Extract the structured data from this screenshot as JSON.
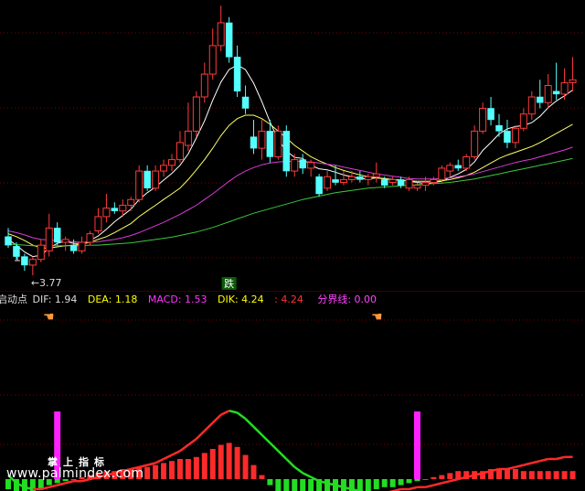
{
  "colors": {
    "background": "#000000",
    "up_candle": "#ff3b3b",
    "down_candle": "#54ffff",
    "ma_white": "#ffffff",
    "ma_yellow": "#ffff66",
    "ma_magenta": "#d83cd8",
    "ma_green": "#3cc83c",
    "dif_label": "#dcdcdc",
    "dea_label": "#ffff00",
    "macd_label": "#ff33ff",
    "dik_label": "#ffff00",
    "dik_value2": "#ff3333",
    "boundary_label": "#ff44ff",
    "signal_bar": "#ff22ff",
    "hist_pos": "#ff2a2a",
    "hist_neg": "#22dd22",
    "dif_line_pos": "#ff2a2a",
    "dif_line_neg": "#22dd22",
    "grid": "#7a0000"
  },
  "annotations": {
    "low_price": "3.77",
    "low_arrow": "←",
    "fall_badge": "跌"
  },
  "legend": {
    "start_point": "启动点",
    "dif": "DIF: 1.94",
    "dea": "DEA: 1.18",
    "macd": "MACD: 1.53",
    "dik": "DIK: 4.24",
    "dik_value2": ": 4.24",
    "boundary": "分界线: 0.00"
  },
  "icons": {
    "signal_hand": "pointing-hand-icon"
  },
  "watermark": {
    "chinese": "掌上指标",
    "url": "www.palmindex.com"
  },
  "chart_data": [
    {
      "type": "candlestick",
      "title": "",
      "ohlc": [
        [
          4.45,
          4.6,
          4.25,
          4.3
        ],
        [
          4.28,
          4.35,
          4.05,
          4.1
        ],
        [
          4.1,
          4.15,
          3.85,
          3.95
        ],
        [
          3.95,
          4.1,
          3.77,
          4.05
        ],
        [
          4.05,
          4.4,
          4.0,
          4.3
        ],
        [
          4.2,
          4.85,
          4.1,
          4.6
        ],
        [
          4.6,
          4.7,
          4.3,
          4.35
        ],
        [
          4.35,
          4.45,
          4.2,
          4.4
        ],
        [
          4.3,
          4.4,
          4.15,
          4.2
        ],
        [
          4.2,
          4.45,
          4.15,
          4.35
        ],
        [
          4.35,
          4.55,
          4.3,
          4.5
        ],
        [
          4.55,
          4.95,
          4.5,
          4.8
        ],
        [
          4.8,
          5.2,
          4.7,
          4.95
        ],
        [
          4.95,
          5.05,
          4.85,
          4.9
        ],
        [
          4.9,
          5.1,
          4.8,
          5.0
        ],
        [
          5.0,
          5.15,
          4.9,
          5.1
        ],
        [
          5.1,
          5.7,
          5.05,
          5.6
        ],
        [
          5.6,
          5.7,
          5.25,
          5.3
        ],
        [
          5.3,
          5.7,
          5.25,
          5.6
        ],
        [
          5.6,
          5.8,
          5.5,
          5.7
        ],
        [
          5.7,
          5.9,
          5.6,
          5.8
        ],
        [
          5.8,
          6.3,
          5.75,
          6.1
        ],
        [
          6.05,
          6.8,
          5.95,
          6.3
        ],
        [
          6.3,
          7.0,
          6.2,
          6.9
        ],
        [
          6.9,
          7.5,
          6.8,
          7.3
        ],
        [
          7.3,
          8.1,
          7.2,
          7.8
        ],
        [
          7.8,
          8.5,
          7.7,
          8.2
        ],
        [
          8.2,
          8.3,
          7.5,
          7.6
        ],
        [
          7.6,
          7.8,
          6.9,
          7.0
        ],
        [
          6.9,
          7.1,
          6.6,
          6.7
        ],
        [
          6.2,
          6.5,
          5.9,
          6.0
        ],
        [
          6.0,
          6.5,
          5.8,
          6.3
        ],
        [
          6.3,
          6.5,
          5.75,
          5.85
        ],
        [
          5.85,
          6.4,
          5.8,
          6.3
        ],
        [
          6.3,
          6.4,
          5.5,
          5.6
        ],
        [
          5.6,
          5.9,
          5.5,
          5.8
        ],
        [
          5.8,
          5.9,
          5.55,
          5.65
        ],
        [
          5.65,
          5.8,
          5.5,
          5.75
        ],
        [
          5.5,
          5.55,
          5.15,
          5.2
        ],
        [
          5.3,
          5.6,
          5.25,
          5.5
        ],
        [
          5.45,
          5.7,
          5.35,
          5.4
        ],
        [
          5.4,
          5.6,
          5.35,
          5.45
        ],
        [
          5.45,
          5.6,
          5.4,
          5.5
        ],
        [
          5.5,
          5.6,
          5.4,
          5.45
        ],
        [
          5.45,
          5.55,
          5.35,
          5.5
        ],
        [
          5.5,
          5.75,
          5.4,
          5.55
        ],
        [
          5.45,
          5.5,
          5.3,
          5.35
        ],
        [
          5.4,
          5.5,
          5.35,
          5.45
        ],
        [
          5.45,
          5.5,
          5.3,
          5.35
        ],
        [
          5.3,
          5.5,
          5.25,
          5.45
        ],
        [
          5.3,
          5.4,
          5.25,
          5.35
        ],
        [
          5.35,
          5.5,
          5.25,
          5.4
        ],
        [
          5.4,
          5.5,
          5.35,
          5.45
        ],
        [
          5.45,
          5.7,
          5.4,
          5.65
        ],
        [
          5.6,
          5.75,
          5.5,
          5.7
        ],
        [
          5.7,
          5.8,
          5.6,
          5.65
        ],
        [
          5.65,
          5.9,
          5.6,
          5.85
        ],
        [
          5.85,
          6.4,
          5.8,
          6.3
        ],
        [
          6.3,
          6.8,
          6.25,
          6.7
        ],
        [
          6.7,
          6.9,
          6.4,
          6.5
        ],
        [
          6.4,
          6.6,
          6.2,
          6.3
        ],
        [
          6.3,
          6.5,
          6.0,
          6.1
        ],
        [
          6.1,
          6.4,
          6.0,
          6.35
        ],
        [
          6.35,
          6.7,
          6.3,
          6.6
        ],
        [
          6.6,
          7.0,
          6.5,
          6.9
        ],
        [
          6.9,
          7.2,
          6.7,
          6.8
        ],
        [
          6.8,
          7.3,
          6.7,
          7.1
        ],
        [
          7.0,
          7.5,
          6.85,
          6.95
        ],
        [
          6.95,
          7.4,
          6.85,
          7.15
        ],
        [
          7.15,
          7.6,
          7.0,
          7.2
        ]
      ],
      "ma_lines": [
        {
          "values": [
            4.4,
            4.3,
            4.18,
            4.1,
            4.12,
            4.25,
            4.33,
            4.37,
            4.33,
            4.33,
            4.38,
            4.46,
            4.58,
            4.71,
            4.82,
            4.93,
            5.1,
            5.22,
            5.32,
            5.44,
            5.56,
            5.7,
            5.9,
            6.18,
            6.48,
            6.84,
            7.16,
            7.38,
            7.46,
            7.38,
            7.14,
            6.82,
            6.46,
            6.15,
            5.95,
            5.84,
            5.82,
            5.7,
            5.64,
            5.62,
            5.58,
            5.53,
            5.5,
            5.47,
            5.46,
            5.48,
            5.47,
            5.45,
            5.44,
            5.42,
            5.4,
            5.38,
            5.4,
            5.42,
            5.49,
            5.55,
            5.63,
            5.76,
            5.96,
            6.1,
            6.25,
            6.34,
            6.38,
            6.4,
            6.45,
            6.56,
            6.71,
            6.83,
            6.92,
            7.02
          ]
        },
        {
          "values": [
            4.5,
            4.45,
            4.38,
            4.3,
            4.25,
            4.25,
            4.27,
            4.29,
            4.3,
            4.32,
            4.35,
            4.4,
            4.45,
            4.52,
            4.6,
            4.68,
            4.8,
            4.9,
            5.0,
            5.1,
            5.2,
            5.3,
            5.45,
            5.62,
            5.8,
            6.0,
            6.22,
            6.4,
            6.52,
            6.58,
            6.58,
            6.52,
            6.42,
            6.3,
            6.18,
            6.05,
            5.95,
            5.85,
            5.78,
            5.72,
            5.66,
            5.61,
            5.57,
            5.53,
            5.5,
            5.48,
            5.46,
            5.45,
            5.44,
            5.43,
            5.42,
            5.42,
            5.42,
            5.43,
            5.45,
            5.48,
            5.52,
            5.58,
            5.66,
            5.74,
            5.82,
            5.88,
            5.93,
            5.98,
            6.03,
            6.1,
            6.18,
            6.26,
            6.34,
            6.42
          ]
        },
        {
          "values": [
            4.55,
            4.52,
            4.48,
            4.43,
            4.4,
            4.39,
            4.38,
            4.37,
            4.36,
            4.35,
            4.35,
            4.36,
            4.38,
            4.4,
            4.43,
            4.47,
            4.52,
            4.58,
            4.64,
            4.7,
            4.77,
            4.84,
            4.92,
            5.0,
            5.1,
            5.2,
            5.31,
            5.42,
            5.52,
            5.6,
            5.66,
            5.71,
            5.74,
            5.76,
            5.77,
            5.77,
            5.77,
            5.76,
            5.74,
            5.72,
            5.7,
            5.67,
            5.64,
            5.61,
            5.58,
            5.55,
            5.53,
            5.51,
            5.49,
            5.47,
            5.46,
            5.46,
            5.46,
            5.47,
            5.48,
            5.5,
            5.52,
            5.55,
            5.59,
            5.63,
            5.67,
            5.71,
            5.75,
            5.78,
            5.81,
            5.85,
            5.89,
            5.93,
            5.97,
            6.02
          ]
        },
        {
          "values": [
            4.32,
            4.31,
            4.3,
            4.29,
            4.29,
            4.29,
            4.29,
            4.29,
            4.29,
            4.29,
            4.3,
            4.3,
            4.31,
            4.32,
            4.33,
            4.34,
            4.36,
            4.38,
            4.4,
            4.42,
            4.44,
            4.47,
            4.5,
            4.53,
            4.57,
            4.61,
            4.66,
            4.71,
            4.76,
            4.81,
            4.86,
            4.9,
            4.94,
            4.98,
            5.02,
            5.06,
            5.1,
            5.13,
            5.16,
            5.19,
            5.22,
            5.24,
            5.26,
            5.28,
            5.3,
            5.31,
            5.32,
            5.33,
            5.34,
            5.35,
            5.36,
            5.37,
            5.38,
            5.39,
            5.4,
            5.42,
            5.44,
            5.46,
            5.49,
            5.52,
            5.55,
            5.58,
            5.61,
            5.64,
            5.67,
            5.7,
            5.73,
            5.76,
            5.79,
            5.82
          ]
        }
      ]
    },
    {
      "type": "bar",
      "title": "",
      "series": [
        {
          "name": "MACD",
          "values": [
            -0.05,
            -0.07,
            -0.08,
            -0.07,
            -0.05,
            -0.03,
            -0.02,
            -0.01,
            0.0,
            0.01,
            0.02,
            0.03,
            0.04,
            0.04,
            0.05,
            0.05,
            0.06,
            0.06,
            0.07,
            0.08,
            0.09,
            0.1,
            0.1,
            0.11,
            0.13,
            0.15,
            0.17,
            0.18,
            0.16,
            0.12,
            0.07,
            0.02,
            -0.03,
            -0.07,
            -0.1,
            -0.12,
            -0.13,
            -0.13,
            -0.12,
            -0.11,
            -0.1,
            -0.09,
            -0.08,
            -0.07,
            -0.06,
            -0.05,
            -0.04,
            -0.04,
            -0.03,
            -0.02,
            -0.01,
            0.0,
            0.01,
            0.02,
            0.03,
            0.04,
            0.04,
            0.04,
            0.04,
            0.05,
            0.05,
            0.05,
            0.05,
            0.04,
            0.04,
            0.04,
            0.04,
            0.04,
            0.04,
            0.04
          ]
        },
        {
          "name": "DIF",
          "values": [
            0.02,
            -0.02,
            -0.04,
            -0.05,
            -0.05,
            -0.04,
            -0.03,
            -0.02,
            -0.01,
            -0.01,
            0.0,
            0.01,
            0.02,
            0.03,
            0.04,
            0.05,
            0.06,
            0.07,
            0.08,
            0.1,
            0.12,
            0.14,
            0.17,
            0.2,
            0.24,
            0.28,
            0.32,
            0.34,
            0.33,
            0.3,
            0.26,
            0.22,
            0.18,
            0.14,
            0.1,
            0.06,
            0.03,
            0.01,
            -0.01,
            -0.02,
            -0.03,
            -0.04,
            -0.05,
            -0.06,
            -0.07,
            -0.07,
            -0.07,
            -0.06,
            -0.05,
            -0.05,
            -0.04,
            -0.04,
            -0.03,
            -0.02,
            -0.01,
            0.0,
            0.01,
            0.02,
            0.03,
            0.04,
            0.05,
            0.05,
            0.06,
            0.07,
            0.08,
            0.09,
            0.1,
            0.1,
            0.11,
            0.11
          ]
        }
      ],
      "signals": [
        6,
        50
      ]
    }
  ]
}
